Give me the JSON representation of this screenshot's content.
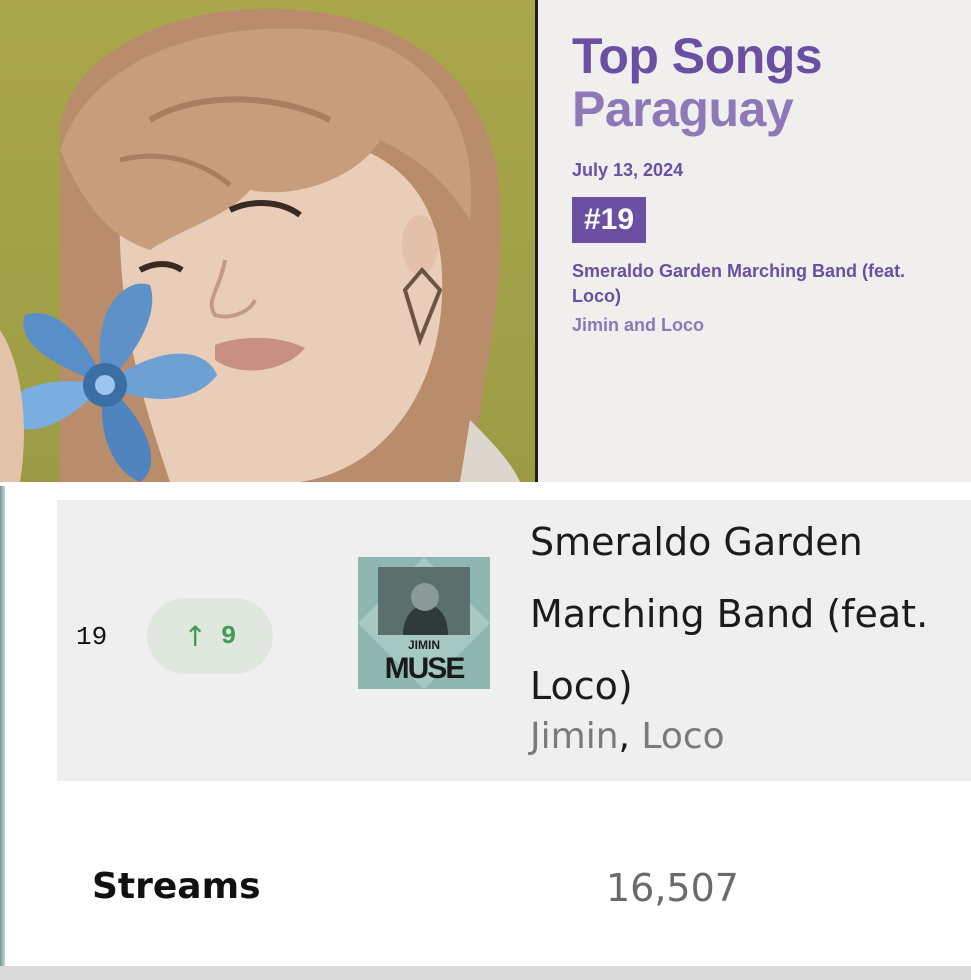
{
  "card": {
    "title": "Top Songs",
    "country": "Paraguay",
    "date": "July 13, 2024",
    "rank": "#19",
    "song": "Smeraldo Garden Marching Band (feat. Loco)",
    "artist": "Jimin and Loco"
  },
  "row": {
    "position": "19",
    "movement_icon": "arrow-up-icon",
    "movement_arrow": "↑",
    "movement_value": "9",
    "album": {
      "line1": "JIMIN",
      "line2": "MUSE"
    },
    "title": "Smeraldo Garden Marching Band (feat. Loco)",
    "artist_primary": "Jimin",
    "artist_separator": ",",
    "artist_secondary": " Loco"
  },
  "streams": {
    "label": "Streams",
    "value": "16,507"
  },
  "colors": {
    "accent_purple": "#6a4fa3",
    "light_purple": "#8d78b8",
    "up_green": "#3f9c55"
  }
}
